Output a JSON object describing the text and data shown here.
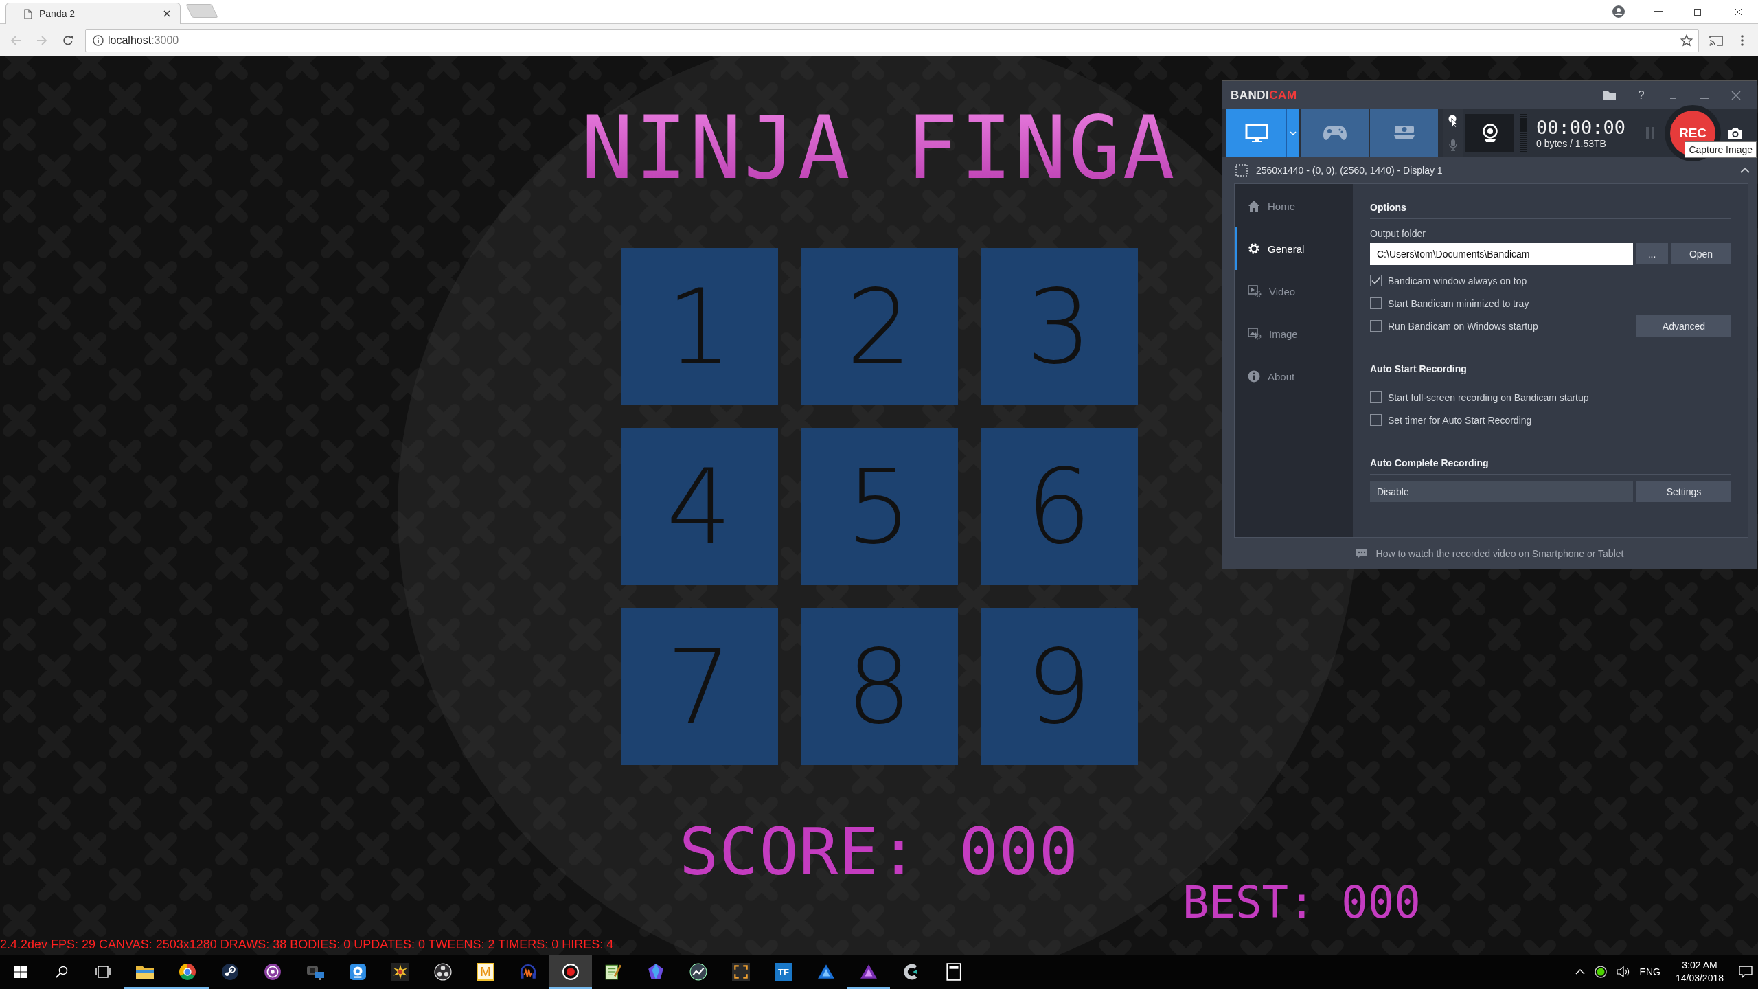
{
  "browser": {
    "tabs": [
      {
        "title": "Panda 2",
        "selected": true
      }
    ],
    "address": {
      "host": "localhost",
      "port": ":3000"
    }
  },
  "game": {
    "title": "NINJA FINGA",
    "tiles": [
      "1",
      "2",
      "3",
      "4",
      "5",
      "6",
      "7",
      "8",
      "9"
    ],
    "score": "SCORE: 000",
    "best": "BEST: 000",
    "debug": "2.4.2dev FPS: 29 CANVAS: 2503x1280 DRAWS: 38 BODIES: 0 UPDATES: 0 TWEENS: 2 TIMERS: 0 HIRES: 4"
  },
  "bandicam": {
    "logo_left": "BANDI",
    "logo_right": "CAM",
    "help": "?",
    "modes": [
      {
        "kind": "screen",
        "selected": true
      },
      {
        "kind": "game",
        "selected": false
      },
      {
        "kind": "hdmi",
        "selected": false
      }
    ],
    "timer": "00:00:00",
    "size": "0 bytes / 1.53TB",
    "rec": "REC",
    "tooltip": "Capture Image",
    "area": "2560x1440 - (0, 0), (2560, 1440) - Display 1",
    "nav": [
      {
        "kind": "home",
        "label": "Home",
        "selected": false
      },
      {
        "kind": "general",
        "label": "General",
        "selected": true
      },
      {
        "kind": "video",
        "label": "Video",
        "selected": false
      },
      {
        "kind": "image",
        "label": "Image",
        "selected": false
      },
      {
        "kind": "about",
        "label": "About",
        "selected": false
      }
    ],
    "sections": [
      {
        "title": "Options",
        "rows": [
          {
            "kind": "label",
            "text": "Output folder"
          },
          {
            "kind": "path",
            "value": "C:\\Users\\tom\\Documents\\Bandicam",
            "buttons": [
              "...",
              "Open"
            ]
          },
          {
            "kind": "checkbox",
            "label": "Bandicam window always on top",
            "checked": true
          },
          {
            "kind": "checkbox",
            "label": "Start Bandicam minimized to tray",
            "checked": false
          },
          {
            "kind": "checkbox",
            "label": "Run Bandicam on Windows startup",
            "checked": false,
            "button": "Advanced"
          }
        ]
      },
      {
        "title": "Auto Start Recording",
        "rows": [
          {
            "kind": "checkbox",
            "label": "Start full-screen recording on Bandicam startup",
            "checked": false
          },
          {
            "kind": "checkbox",
            "label": "Set timer for Auto Start Recording",
            "checked": false
          }
        ]
      },
      {
        "title": "Auto Complete Recording",
        "rows": [
          {
            "kind": "select",
            "value": "Disable",
            "button": "Settings"
          }
        ]
      }
    ],
    "footer": "How to watch the recorded video on Smartphone or Tablet"
  },
  "taskbar": {
    "apps": [
      {
        "kind": "explorer",
        "running": true,
        "selected": false
      },
      {
        "kind": "chrome",
        "running": true,
        "selected": false
      },
      {
        "kind": "steam",
        "running": false,
        "selected": false
      },
      {
        "kind": "gog",
        "running": false,
        "selected": false
      },
      {
        "kind": "camera",
        "running": false,
        "selected": false
      },
      {
        "kind": "webcam",
        "running": false,
        "selected": false
      },
      {
        "kind": "sun",
        "running": false,
        "selected": false
      },
      {
        "kind": "obs",
        "running": false,
        "selected": false
      },
      {
        "kind": "tile",
        "label": "M",
        "running": false,
        "selected": false
      },
      {
        "kind": "audacity",
        "running": false,
        "selected": false
      },
      {
        "kind": "bandicam",
        "running": true,
        "selected": true
      },
      {
        "kind": "notepad",
        "running": false,
        "selected": false
      },
      {
        "kind": "crystal",
        "running": false,
        "selected": false
      },
      {
        "kind": "chart",
        "running": false,
        "selected": false
      },
      {
        "kind": "corners",
        "running": false,
        "selected": false
      },
      {
        "kind": "cube",
        "label": "TF",
        "running": false,
        "selected": false
      },
      {
        "kind": "designer",
        "running": false,
        "selected": false
      },
      {
        "kind": "photo",
        "running": true,
        "selected": false
      },
      {
        "kind": "crescent",
        "running": false,
        "selected": false
      },
      {
        "kind": "calculator",
        "running": false,
        "selected": false
      }
    ],
    "tray": {
      "language": "ENG",
      "time": "3:02 AM",
      "date": "14/03/2018"
    }
  }
}
